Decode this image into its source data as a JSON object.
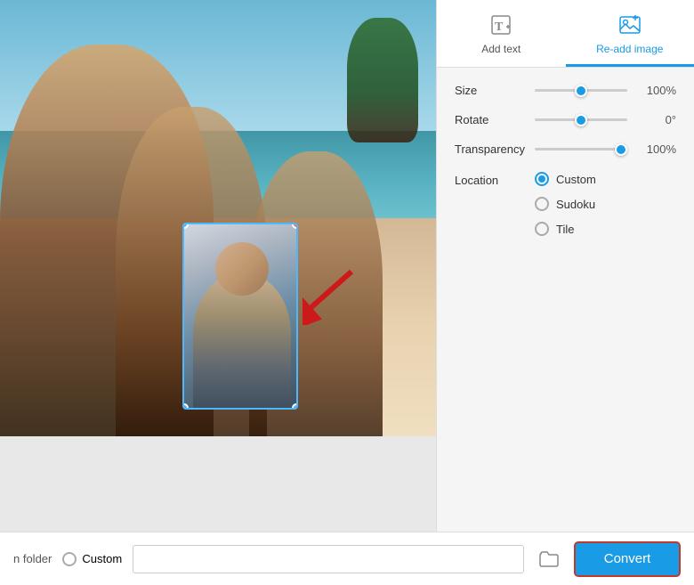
{
  "toolbar": {
    "add_text_label": "Add text",
    "readd_image_label": "Re-add image"
  },
  "controls": {
    "size_label": "Size",
    "size_value": "100%",
    "size_slider": 100,
    "rotate_label": "Rotate",
    "rotate_value": "0°",
    "rotate_slider": 0,
    "transparency_label": "Transparency",
    "transparency_value": "100%",
    "transparency_slider": 100,
    "location_label": "Location",
    "location_options": [
      {
        "label": "Custom",
        "checked": true
      },
      {
        "label": "Sudoku",
        "checked": false
      },
      {
        "label": "Tile",
        "checked": false
      }
    ]
  },
  "bottom_bar": {
    "folder_label": "n folder",
    "custom_label": "Custom",
    "path_value": "",
    "path_placeholder": "",
    "folder_icon": "📁",
    "convert_label": "Convert"
  }
}
